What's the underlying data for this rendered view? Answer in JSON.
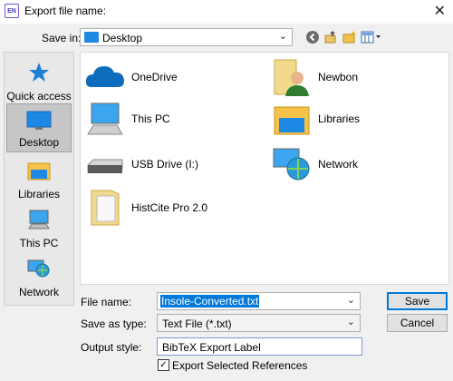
{
  "window": {
    "title": "Export file name:",
    "app_icon_text": "EN"
  },
  "toolbar": {
    "save_in_label": "Save in:",
    "save_in_value": "Desktop",
    "icons": [
      "back-icon",
      "up-folder-icon",
      "new-folder-icon",
      "view-menu-icon"
    ]
  },
  "places": [
    {
      "label": "Quick access",
      "icon": "star-icon"
    },
    {
      "label": "Desktop",
      "icon": "desktop-icon",
      "selected": true
    },
    {
      "label": "Libraries",
      "icon": "libraries-icon"
    },
    {
      "label": "This PC",
      "icon": "computer-icon"
    },
    {
      "label": "Network",
      "icon": "network-icon"
    }
  ],
  "files": [
    {
      "name": "OneDrive",
      "icon": "cloud-icon"
    },
    {
      "name": "Newbon",
      "icon": "user-folder-icon"
    },
    {
      "name": "This PC",
      "icon": "computer-icon"
    },
    {
      "name": "Libraries",
      "icon": "libraries-icon"
    },
    {
      "name": "USB Drive (I:)",
      "icon": "drive-icon"
    },
    {
      "name": "Network",
      "icon": "network-icon"
    },
    {
      "name": "HistCite Pro 2.0",
      "icon": "folder-icon"
    }
  ],
  "form": {
    "file_name_label": "File name:",
    "file_name_value": "Insole-Converted.txt",
    "save_as_type_label": "Save as type:",
    "save_as_type_value": "Text File (*.txt)",
    "output_style_label": "Output style:",
    "output_style_value": "BibTeX Export Label",
    "export_selected_label": "Export Selected References",
    "export_selected_checked": true
  },
  "buttons": {
    "save": "Save",
    "cancel": "Cancel"
  }
}
